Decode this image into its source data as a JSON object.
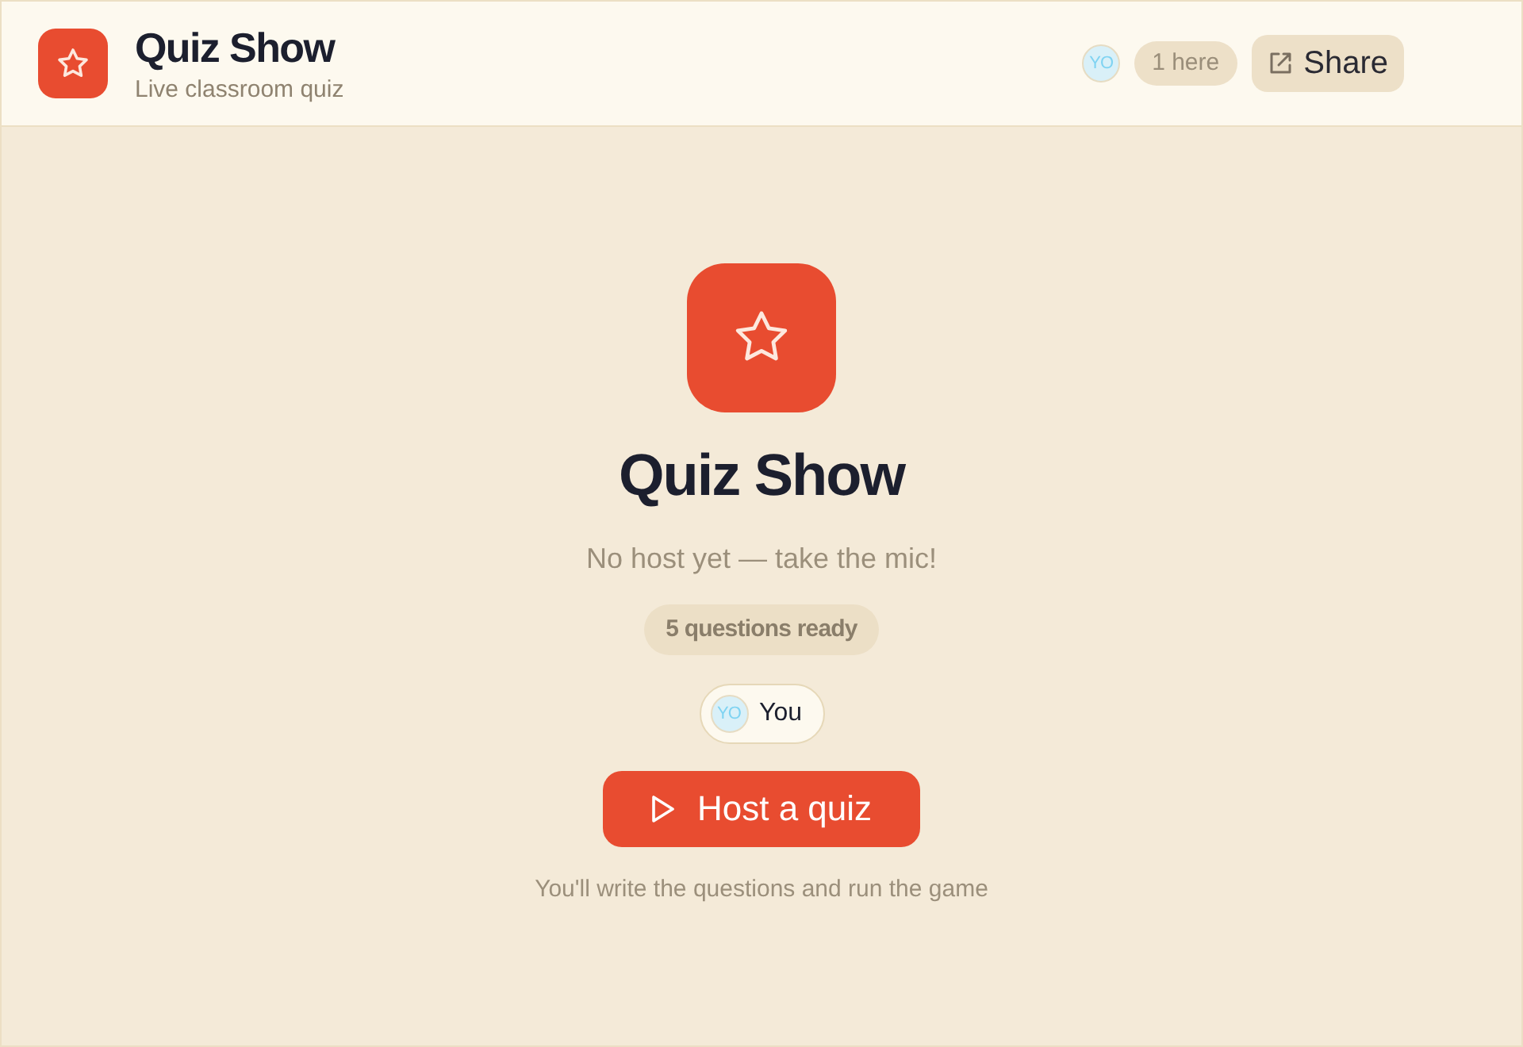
{
  "header": {
    "title": "Quiz Show",
    "subtitle": "Live classroom quiz",
    "presence": {
      "avatars": [
        {
          "initials": "YO"
        }
      ],
      "count": "1 here"
    },
    "share_button": "Share"
  },
  "hero": {
    "title": "Quiz Show",
    "status": "No host yet — take the mic!",
    "badge": "5 questions ready",
    "players": [
      {
        "initials": "YO",
        "name": "You"
      }
    ],
    "primary_button": "Host a quiz",
    "hint": "You'll write the questions and run the game"
  }
}
